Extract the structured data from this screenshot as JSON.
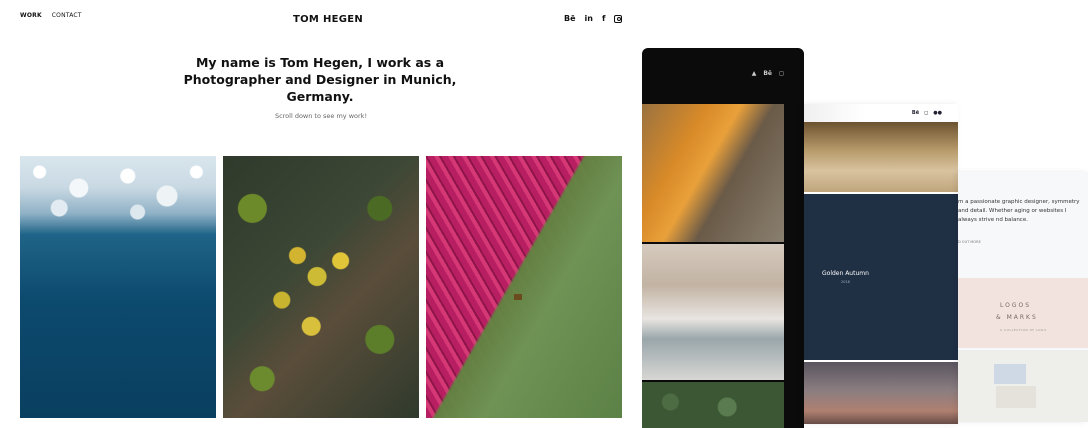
{
  "nav": {
    "work": "WORK",
    "contact": "CONTACT"
  },
  "brand": "TOM HEGEN",
  "social": {
    "behance": "Bē",
    "linkedin": "in",
    "facebook": "f"
  },
  "headline": "My name is Tom Hegen, I work as a Photographer and Designer in Munich, Germany.",
  "subline": "Scroll down to see my work!",
  "screens": {
    "dark_social": {
      "behance": "Bē"
    },
    "light_social": {
      "behance": "Bē"
    },
    "golden_title": "Golden Autumn",
    "golden_year": "2018",
    "about_text": "m a passionate graphic designer, symmetry and detail. Whether aging or websites I always strive nd balance.",
    "about_more": "D OUT MORE",
    "logos_line1": "LOGOS",
    "logos_line2": "& MARKS",
    "logos_line3": "A COLLECTION OF LOGO"
  }
}
